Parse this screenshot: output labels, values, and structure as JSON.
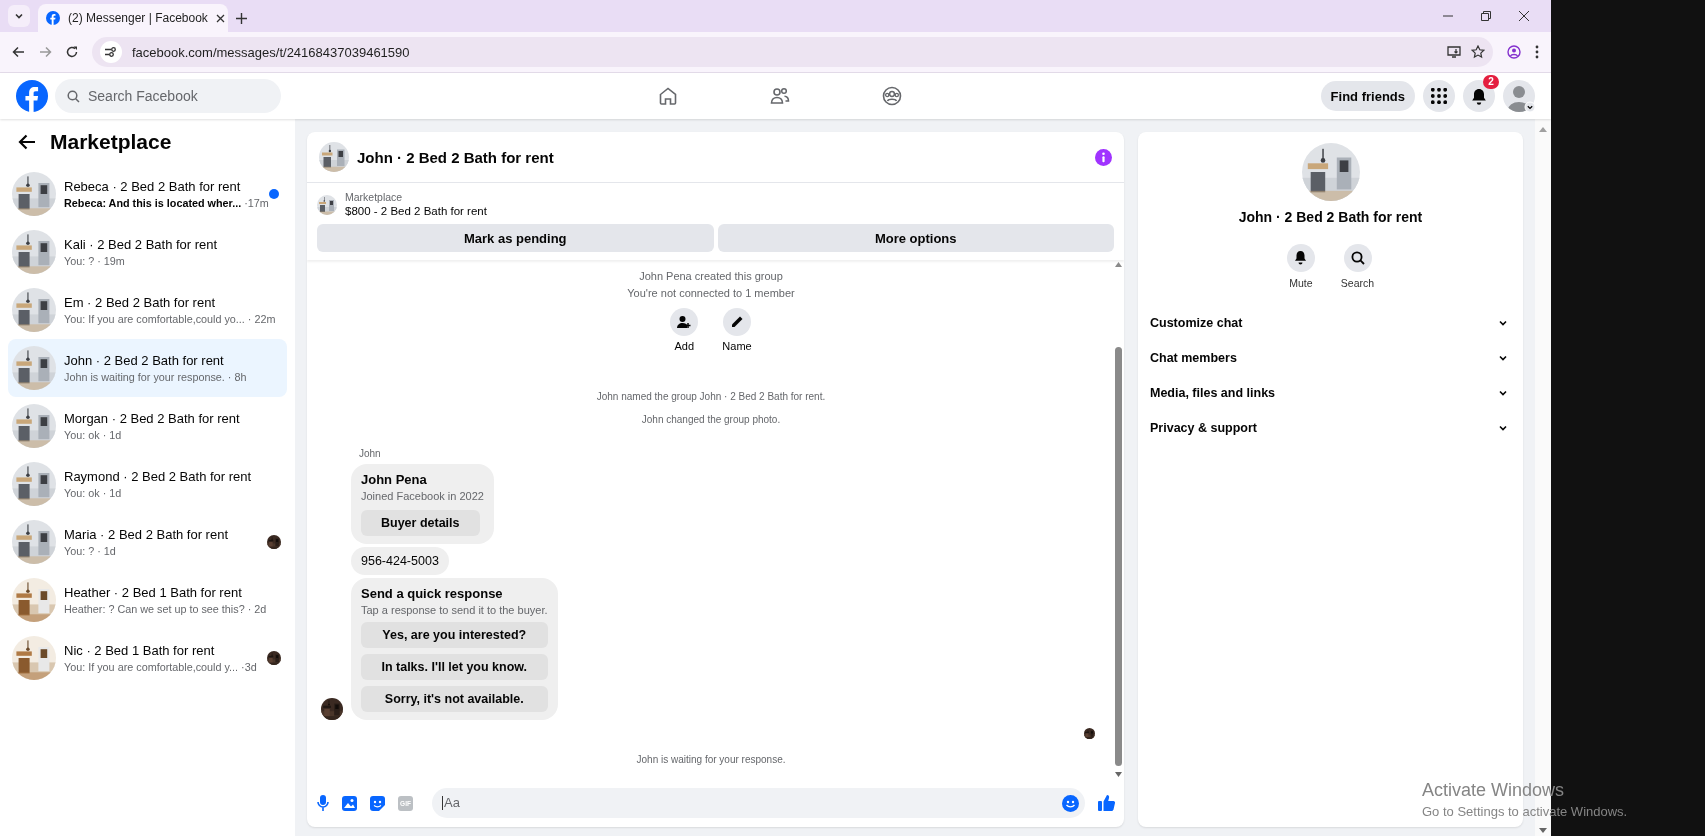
{
  "browser": {
    "tab_title": "(2) Messenger | Facebook",
    "url": "facebook.com/messages/t/24168437039461590"
  },
  "header": {
    "search_placeholder": "Search Facebook",
    "find_friends": "Find friends",
    "notification_count": "2"
  },
  "sidebar": {
    "title": "Marketplace",
    "conversations": [
      {
        "title": "Rebeca · 2 Bed 2 Bath for rent",
        "snippet": "Rebeca: And this is located wher...",
        "time": "·17m",
        "selected": false,
        "unread": true,
        "seen_avatar": false
      },
      {
        "title": "Kali · 2 Bed 2 Bath for rent",
        "snippet": "You: ?",
        "time": "· 19m",
        "selected": false,
        "unread": false,
        "seen_avatar": false
      },
      {
        "title": "Em · 2 Bed 2 Bath for rent",
        "snippet": "You: If you are comfortable,could yo...",
        "time": "· 22m",
        "selected": false,
        "unread": false,
        "seen_avatar": false
      },
      {
        "title": "John · 2 Bed 2 Bath for rent",
        "snippet": "John is waiting for your response.",
        "time": "· 8h",
        "selected": true,
        "unread": false,
        "seen_avatar": false
      },
      {
        "title": "Morgan · 2 Bed 2 Bath for rent",
        "snippet": "You: ok",
        "time": "· 1d",
        "selected": false,
        "unread": false,
        "seen_avatar": false
      },
      {
        "title": "Raymond · 2 Bed 2 Bath for rent",
        "snippet": "You: ok",
        "time": "· 1d",
        "selected": false,
        "unread": false,
        "seen_avatar": false
      },
      {
        "title": "Maria · 2 Bed 2 Bath for rent",
        "snippet": "You: ?",
        "time": "· 1d",
        "selected": false,
        "unread": false,
        "seen_avatar": true
      },
      {
        "title": "Heather · 2 Bed 1 Bath for rent",
        "snippet": "Heather: ? Can we set up to see this?",
        "time": "· 2d",
        "selected": false,
        "unread": false,
        "seen_avatar": false
      },
      {
        "title": "Nic · 2 Bed 1 Bath for rent",
        "snippet": "You: If you are comfortable,could y...",
        "time": "·3d",
        "selected": false,
        "unread": false,
        "seen_avatar": true
      }
    ]
  },
  "chat": {
    "title": "John · 2 Bed 2 Bath for rent",
    "listing": {
      "label": "Marketplace",
      "price_title": "$800 - 2 Bed 2 Bath for rent"
    },
    "actions": [
      "Mark as pending",
      "More options"
    ],
    "events": [
      "John Pena created this group",
      "You're not connected to 1 member"
    ],
    "group_actions": [
      {
        "kind": "add",
        "label": "Add"
      },
      {
        "kind": "name",
        "label": "Name"
      }
    ],
    "notices": [
      "John named the group John · 2 Bed 2 Bath for rent.",
      "John changed the group photo."
    ],
    "sender": "John",
    "profile_card": {
      "name": "John Pena",
      "subtitle": "Joined Facebook in 2022",
      "button": "Buyer details"
    },
    "phone": "956-424-5003",
    "quick_response": {
      "title": "Send a quick response",
      "subtitle": "Tap a response to send it to the buyer.",
      "options": [
        "Yes, are you interested?",
        "In talks. I'll let you know.",
        "Sorry, it's not available."
      ]
    },
    "footer_notice": "John is waiting for your response.",
    "composer": {
      "placeholder": "Aa",
      "gif_label": "GIF"
    }
  },
  "info_panel": {
    "title": "John · 2 Bed 2 Bath for rent",
    "actions": [
      {
        "kind": "mute",
        "label": "Mute"
      },
      {
        "kind": "search",
        "label": "Search"
      }
    ],
    "sections": [
      {
        "label": "Customize chat",
        "expanded": false
      },
      {
        "label": "Chat members",
        "expanded": false
      },
      {
        "label": "Media, files and links",
        "expanded": false
      },
      {
        "label": "Privacy & support",
        "expanded": false
      }
    ]
  },
  "os_watermark": {
    "title": "Activate Windows",
    "subtitle": "Go to Settings to activate Windows."
  }
}
